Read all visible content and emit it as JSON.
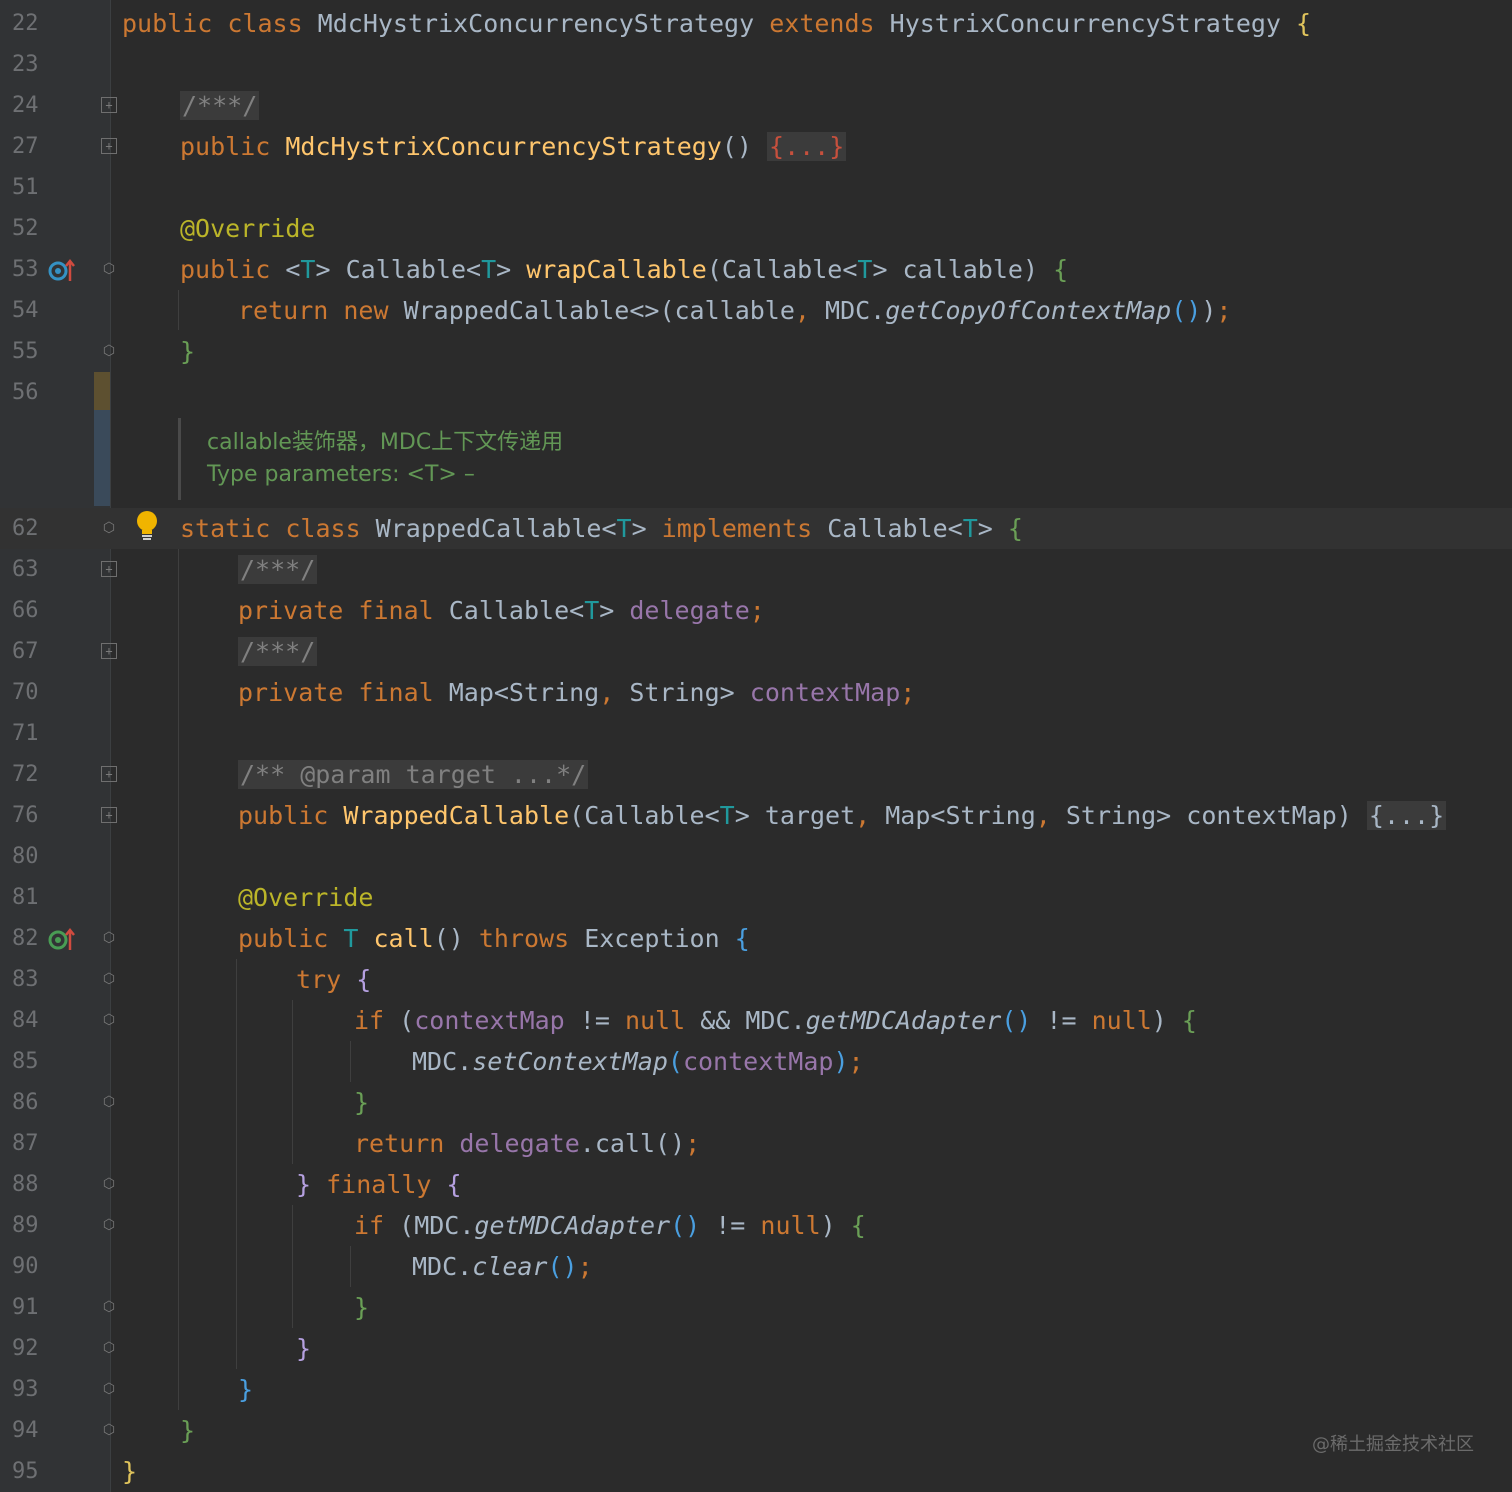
{
  "editor": {
    "lines": [
      {
        "num": "22",
        "tokens": [
          [
            "kw",
            "public class "
          ],
          [
            "",
            "MdcHystrixConcurrencyStrategy "
          ],
          [
            "kw",
            "extends "
          ],
          [
            "",
            "HystrixConcurrencyStrategy "
          ],
          [
            "br1",
            "{"
          ]
        ]
      },
      {
        "num": "23",
        "tokens": []
      },
      {
        "num": "24",
        "tokens": [
          [
            "cm doccmt",
            "/***/"
          ]
        ]
      },
      {
        "num": "27",
        "tokens": [
          [
            "kw",
            "public "
          ],
          [
            "fn",
            "MdcHystrixConcurrencyStrategy"
          ],
          [
            "",
            "() "
          ],
          [
            "fold-stub red",
            "{...}"
          ]
        ]
      },
      {
        "num": "51",
        "tokens": []
      },
      {
        "num": "52",
        "tokens": [
          [
            "ann",
            "@Override"
          ]
        ]
      },
      {
        "num": "53",
        "tokens": [
          [
            "kw",
            "public "
          ],
          [
            "",
            "<"
          ],
          [
            "tp",
            "T"
          ],
          [
            "",
            "> Callable<"
          ],
          [
            "tp",
            "T"
          ],
          [
            "",
            "> "
          ],
          [
            "fn",
            "wrapCallable"
          ],
          [
            "",
            "(Callable<"
          ],
          [
            "tp",
            "T"
          ],
          [
            "",
            "> callable) "
          ],
          [
            "br2",
            "{"
          ]
        ]
      },
      {
        "num": "54",
        "tokens": [
          [
            "kw",
            "return new "
          ],
          [
            "",
            "WrappedCallable<>(callable"
          ],
          [
            "kw",
            ", "
          ],
          [
            "",
            "MDC."
          ],
          [
            "it",
            "getCopyOfContextMap"
          ],
          [
            "br3",
            "()"
          ],
          [
            "",
            ")"
          ],
          [
            "kw",
            ";"
          ]
        ]
      },
      {
        "num": "55",
        "tokens": [
          [
            "br2",
            "}"
          ]
        ]
      },
      {
        "num": "56",
        "tokens": []
      },
      {
        "num": "62",
        "tokens": [
          [
            "kw",
            "static class "
          ],
          [
            "",
            "WrappedCallable<"
          ],
          [
            "tp",
            "T"
          ],
          [
            "",
            "> "
          ],
          [
            "kw",
            "implements "
          ],
          [
            "",
            "Callable<"
          ],
          [
            "tp",
            "T"
          ],
          [
            "",
            "> "
          ],
          [
            "br2",
            "{"
          ]
        ]
      },
      {
        "num": "63",
        "tokens": [
          [
            "cm doccmt",
            "/***/"
          ]
        ]
      },
      {
        "num": "66",
        "tokens": [
          [
            "kw",
            "private final "
          ],
          [
            "",
            "Callable<"
          ],
          [
            "tp",
            "T"
          ],
          [
            "",
            "> "
          ],
          [
            "fld",
            "delegate"
          ],
          [
            "kw",
            ";"
          ]
        ]
      },
      {
        "num": "67",
        "tokens": [
          [
            "cm doccmt",
            "/***/"
          ]
        ]
      },
      {
        "num": "70",
        "tokens": [
          [
            "kw",
            "private final "
          ],
          [
            "",
            "Map<String"
          ],
          [
            "kw",
            ", "
          ],
          [
            "",
            "String> "
          ],
          [
            "fld",
            "contextMap"
          ],
          [
            "kw",
            ";"
          ]
        ]
      },
      {
        "num": "71",
        "tokens": []
      },
      {
        "num": "72",
        "tokens": [
          [
            "cm doccmt",
            "/** @param target ...*/"
          ]
        ]
      },
      {
        "num": "76",
        "tokens": [
          [
            "kw",
            "public "
          ],
          [
            "fn",
            "WrappedCallable"
          ],
          [
            "",
            "(Callable<"
          ],
          [
            "tp",
            "T"
          ],
          [
            "",
            "> target"
          ],
          [
            "kw",
            ", "
          ],
          [
            "",
            "Map<String"
          ],
          [
            "kw",
            ", "
          ],
          [
            "",
            "String> contextMap) "
          ],
          [
            "fold-stub",
            "{...}"
          ]
        ]
      },
      {
        "num": "80",
        "tokens": []
      },
      {
        "num": "81",
        "tokens": [
          [
            "ann",
            "@Override"
          ]
        ]
      },
      {
        "num": "82",
        "tokens": [
          [
            "kw",
            "public "
          ],
          [
            "tp",
            "T "
          ],
          [
            "fn",
            "call"
          ],
          [
            "",
            "() "
          ],
          [
            "kw",
            "throws "
          ],
          [
            "",
            "Exception "
          ],
          [
            "br3",
            "{"
          ]
        ]
      },
      {
        "num": "83",
        "tokens": [
          [
            "kw",
            "try "
          ],
          [
            "br4",
            "{"
          ]
        ]
      },
      {
        "num": "84",
        "tokens": [
          [
            "kw",
            "if "
          ],
          [
            "",
            "("
          ],
          [
            "fld",
            "contextMap "
          ],
          [
            "",
            "!= "
          ],
          [
            "kw",
            "null "
          ],
          [
            "",
            "&& MDC."
          ],
          [
            "it",
            "getMDCAdapter"
          ],
          [
            "br3",
            "()"
          ],
          [
            "",
            " != "
          ],
          [
            "kw",
            "null"
          ],
          [
            "",
            ") "
          ],
          [
            "br2",
            "{"
          ]
        ]
      },
      {
        "num": "85",
        "tokens": [
          [
            "",
            "MDC."
          ],
          [
            "it",
            "setContextMap"
          ],
          [
            "br3",
            "("
          ],
          [
            "fld",
            "contextMap"
          ],
          [
            "br3",
            ")"
          ],
          [
            "kw",
            ";"
          ]
        ]
      },
      {
        "num": "86",
        "tokens": [
          [
            "br2",
            "}"
          ]
        ]
      },
      {
        "num": "87",
        "tokens": [
          [
            "kw",
            "return "
          ],
          [
            "fld",
            "delegate"
          ],
          [
            "",
            ".call()"
          ],
          [
            "kw",
            ";"
          ]
        ]
      },
      {
        "num": "88",
        "tokens": [
          [
            "br4",
            "} "
          ],
          [
            "kw",
            "finally "
          ],
          [
            "br4",
            "{"
          ]
        ]
      },
      {
        "num": "89",
        "tokens": [
          [
            "kw",
            "if "
          ],
          [
            "",
            "(MDC."
          ],
          [
            "it",
            "getMDCAdapter"
          ],
          [
            "br3",
            "()"
          ],
          [
            "",
            " != "
          ],
          [
            "kw",
            "null"
          ],
          [
            "",
            ") "
          ],
          [
            "br2",
            "{"
          ]
        ]
      },
      {
        "num": "90",
        "tokens": [
          [
            "",
            "MDC."
          ],
          [
            "it",
            "clear"
          ],
          [
            "br3",
            "()"
          ],
          [
            "kw",
            ";"
          ]
        ]
      },
      {
        "num": "91",
        "tokens": [
          [
            "br2",
            "}"
          ]
        ]
      },
      {
        "num": "92",
        "tokens": [
          [
            "br4",
            "}"
          ]
        ]
      },
      {
        "num": "93",
        "tokens": [
          [
            "br3",
            "}"
          ]
        ]
      },
      {
        "num": "94",
        "tokens": [
          [
            "br2",
            "}"
          ]
        ]
      },
      {
        "num": "95",
        "tokens": [
          [
            "br1",
            "}"
          ]
        ]
      }
    ],
    "doc": {
      "line1": "callable装饰器，MDC上下文传递用",
      "line2": "Type parameters: <T> –"
    }
  },
  "watermark": "@稀土掘金技术社区",
  "colors": {
    "background": "#2b2b2b",
    "gutter": "#313335",
    "keyword": "#cc7832",
    "function": "#ffc66d",
    "annotation": "#bbb529",
    "field": "#9876aa",
    "doc_comment": "#629755"
  },
  "icons": [
    "fold-arrow-icon",
    "fold-box-icon",
    "override-icon",
    "implemented-icon",
    "lightbulb-icon"
  ]
}
